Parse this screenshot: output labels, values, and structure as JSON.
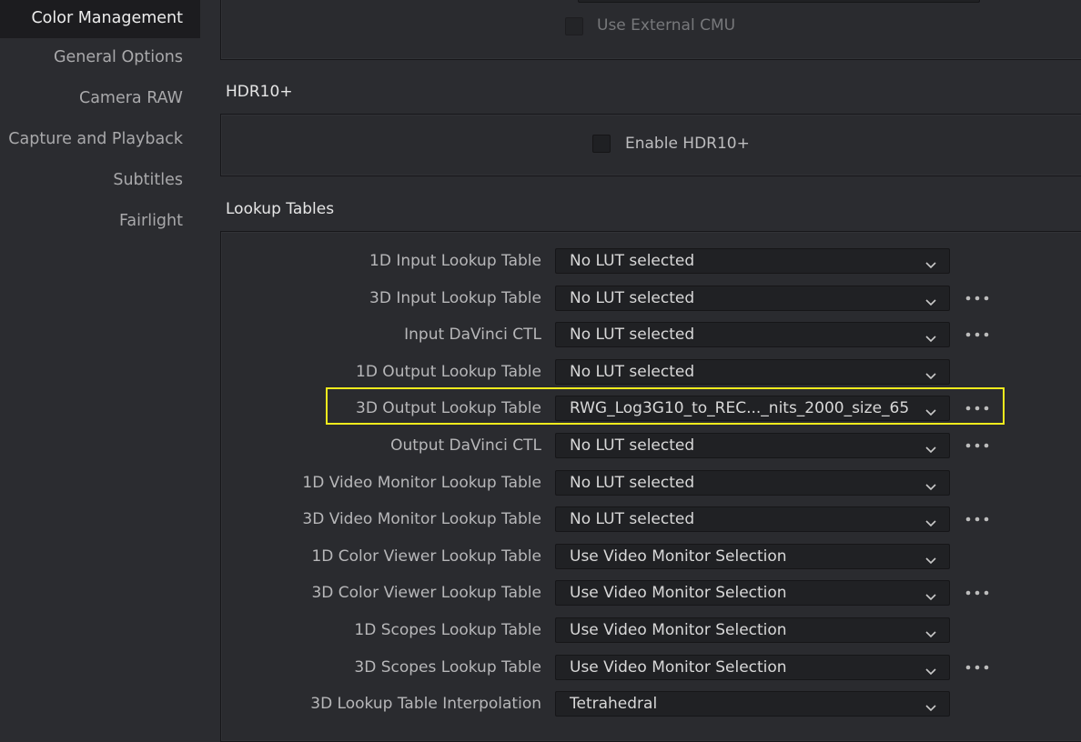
{
  "sidebar": {
    "items": [
      {
        "label": "Color Management",
        "active": true
      },
      {
        "label": "General Options",
        "active": false
      },
      {
        "label": "Camera RAW",
        "active": false
      },
      {
        "label": "Capture and Playback",
        "active": false
      },
      {
        "label": "Subtitles",
        "active": false
      },
      {
        "label": "Fairlight",
        "active": false
      }
    ]
  },
  "top_section": {
    "use_external_cmu_label": "Use External CMU",
    "use_external_cmu_checked": false
  },
  "hdr10plus": {
    "title": "HDR10+",
    "enable_label": "Enable HDR10+",
    "enable_checked": false
  },
  "lookup_tables": {
    "title": "Lookup Tables",
    "rows": [
      {
        "label": "1D Input Lookup Table",
        "value": "No LUT selected",
        "has_more": false
      },
      {
        "label": "3D Input Lookup Table",
        "value": "No LUT selected",
        "has_more": true
      },
      {
        "label": "Input DaVinci CTL",
        "value": "No LUT selected",
        "has_more": true
      },
      {
        "label": "1D Output Lookup Table",
        "value": "No LUT selected",
        "has_more": false
      },
      {
        "label": "3D Output Lookup Table",
        "value": "RWG_Log3G10_to_REC..._nits_2000_size_65",
        "has_more": true,
        "highlighted": true
      },
      {
        "label": "Output DaVinci CTL",
        "value": "No LUT selected",
        "has_more": true
      },
      {
        "label": "1D Video Monitor Lookup Table",
        "value": "No LUT selected",
        "has_more": false
      },
      {
        "label": "3D Video Monitor Lookup Table",
        "value": "No LUT selected",
        "has_more": true
      },
      {
        "label": "1D Color Viewer Lookup Table",
        "value": "Use Video Monitor Selection",
        "has_more": false
      },
      {
        "label": "3D Color Viewer Lookup Table",
        "value": "Use Video Monitor Selection",
        "has_more": true
      },
      {
        "label": "1D Scopes Lookup Table",
        "value": "Use Video Monitor Selection",
        "has_more": false
      },
      {
        "label": "3D Scopes Lookup Table",
        "value": "Use Video Monitor Selection",
        "has_more": true
      },
      {
        "label": "3D Lookup Table Interpolation",
        "value": "Tetrahedral",
        "has_more": false
      }
    ]
  },
  "colors": {
    "background": "#2b2c30",
    "highlight": "#f3eb1d",
    "field_bg": "#202124"
  }
}
